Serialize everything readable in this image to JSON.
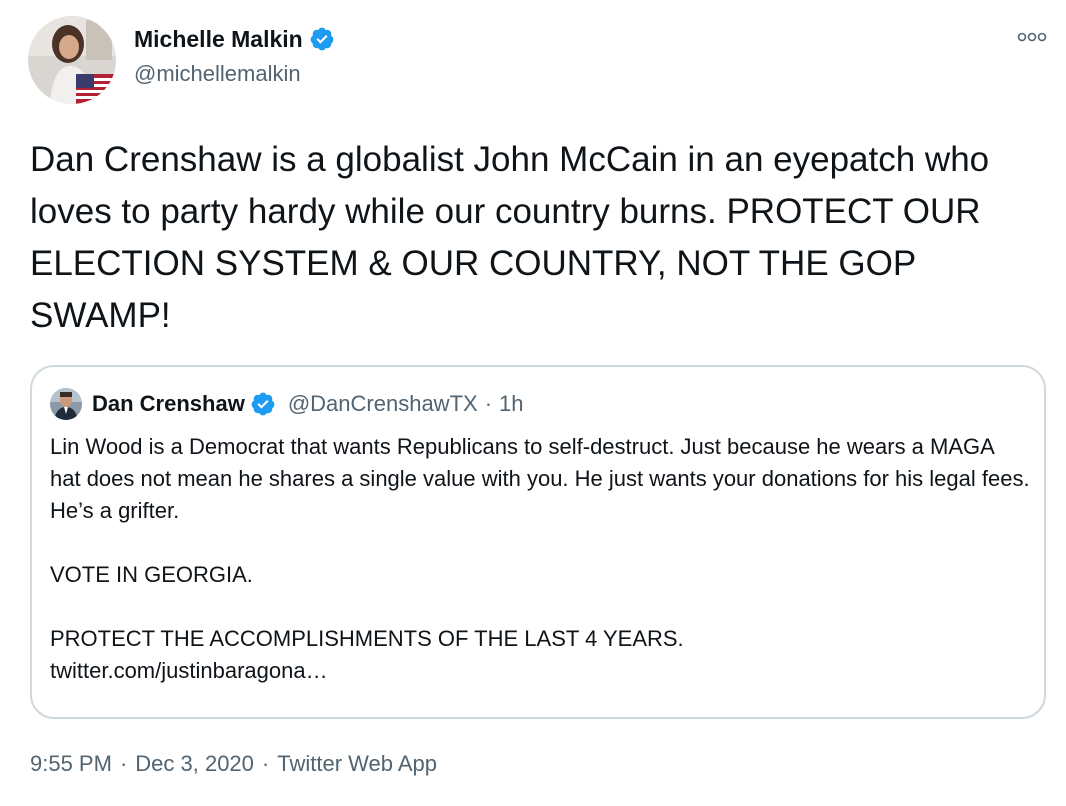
{
  "author": {
    "name": "Michelle Malkin",
    "handle": "@michellemalkin",
    "verified_icon": "verified-badge-icon"
  },
  "tweet": {
    "text": "Dan Crenshaw is a globalist John McCain in an eyepatch who loves to party hardy while our country burns. PROTECT OUR ELECTION SYSTEM & OUR COUNTRY, NOT THE GOP SWAMP!"
  },
  "quote": {
    "name": "Dan Crenshaw",
    "handle": "@DanCrenshawTX",
    "dot": "·",
    "time": "1h",
    "paragraph1": "Lin Wood is a Democrat that wants Republicans to self-destruct. Just because he wears a MAGA hat does not mean he shares a single value with you. He just wants your donations for his legal fees. He’s a grifter.",
    "paragraph2": "VOTE IN GEORGIA.",
    "paragraph3": "PROTECT THE ACCOMPLISHMENTS OF THE LAST 4 YEARS.",
    "link": "twitter.com/justinbaragona…"
  },
  "footer": {
    "time": "9:55 PM",
    "sep1": "·",
    "date": "Dec 3, 2020",
    "sep2": "·",
    "source": "Twitter Web App"
  },
  "colors": {
    "verified_blue": "#1d9bf0",
    "secondary_text": "#536471",
    "border": "#cfd9de"
  },
  "icons": {
    "more": "more-horizontal-icon"
  }
}
